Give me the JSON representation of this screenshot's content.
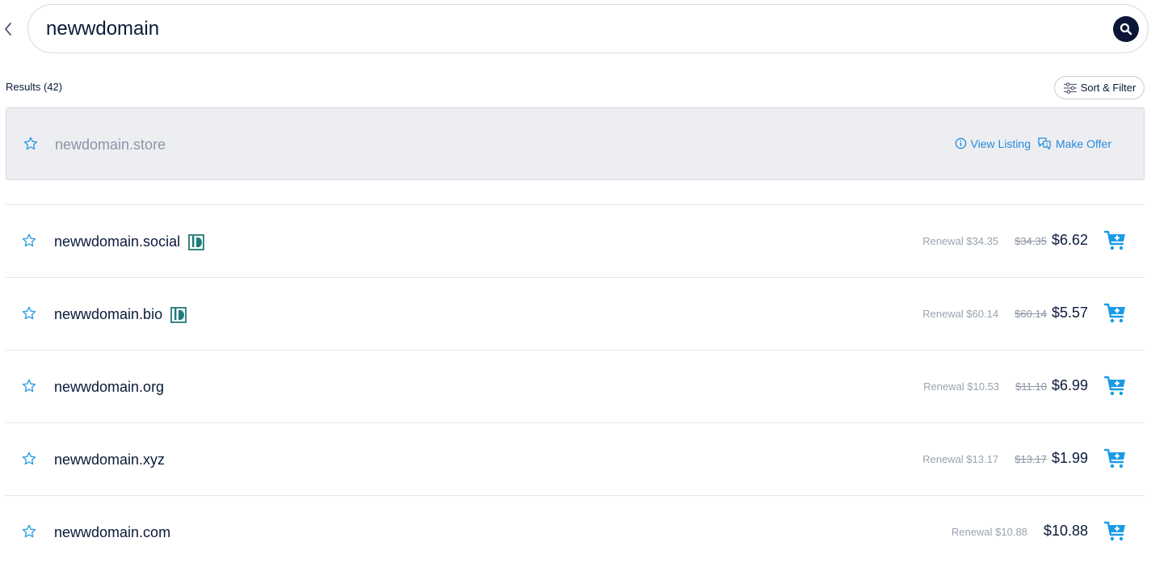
{
  "search": {
    "value": "newwdomain"
  },
  "results": {
    "label": "Results (42)",
    "sort_filter_label": "Sort & Filter"
  },
  "featured": {
    "domain": "newdomain.store",
    "view_listing_label": "View Listing",
    "make_offer_label": "Make Offer"
  },
  "rows": [
    {
      "domain": "newwdomain.social",
      "badge": true,
      "renewal": "Renewal $34.35",
      "old_price": "$34.35",
      "price": "$6.62"
    },
    {
      "domain": "newwdomain.bio",
      "badge": true,
      "renewal": "Renewal $60.14",
      "old_price": "$60.14",
      "price": "$5.57"
    },
    {
      "domain": "newwdomain.org",
      "badge": false,
      "renewal": "Renewal $10.53",
      "old_price": "$11.10",
      "price": "$6.99"
    },
    {
      "domain": "newwdomain.xyz",
      "badge": false,
      "renewal": "Renewal $13.17",
      "old_price": "$13.17",
      "price": "$1.99"
    },
    {
      "domain": "newwdomain.com",
      "badge": false,
      "renewal": "Renewal $10.88",
      "old_price": "",
      "price": "$10.88"
    }
  ],
  "colors": {
    "accent": "#1a9be6",
    "link": "#2a8ad8",
    "text": "#0b1a3a",
    "search_button": "#0b1636",
    "badge": "#1f7a7a"
  },
  "icons": {
    "back": "chevron-left-icon",
    "search": "search-icon",
    "sort": "sliders-icon",
    "star": "star-outline-icon",
    "info": "info-icon",
    "offer": "offer-chat-icon",
    "cart": "add-to-cart-icon",
    "badge": "domain-badge-icon"
  }
}
